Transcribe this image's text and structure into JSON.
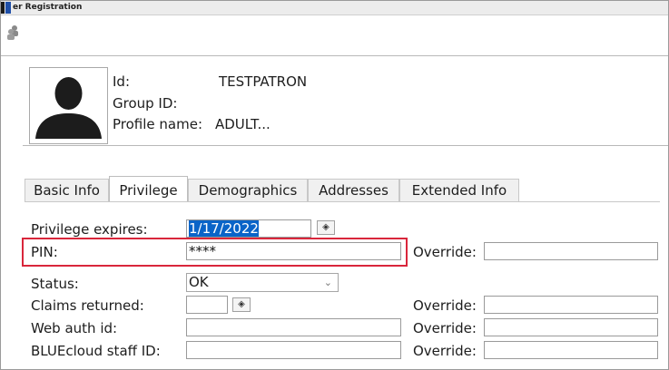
{
  "window": {
    "title": "er Registration"
  },
  "toolbar": {
    "icon": "users-icon"
  },
  "header": {
    "id_label": "Id:",
    "id_value": "TESTPATRON",
    "group_label": "Group ID:",
    "profile_label": "Profile name:",
    "profile_value": "ADULT..."
  },
  "tabs": [
    {
      "label": "Basic Info"
    },
    {
      "label": "Privilege"
    },
    {
      "label": "Demographics"
    },
    {
      "label": "Addresses"
    },
    {
      "label": "Extended Info"
    }
  ],
  "form": {
    "privilege_expires_label": "Privilege expires:",
    "privilege_expires_value": "1/17/2022",
    "pin_label": "PIN:",
    "pin_value": "****",
    "status_label": "Status:",
    "status_value": "OK",
    "claims_label": "Claims returned:",
    "claims_value": "",
    "web_auth_label": "Web auth id:",
    "web_auth_value": "",
    "bluecloud_label": "BLUEcloud staff ID:",
    "bluecloud_value": "",
    "override_label": "Override:"
  },
  "colors": {
    "highlight": "#d9263b",
    "selection": "#0a64c8"
  }
}
